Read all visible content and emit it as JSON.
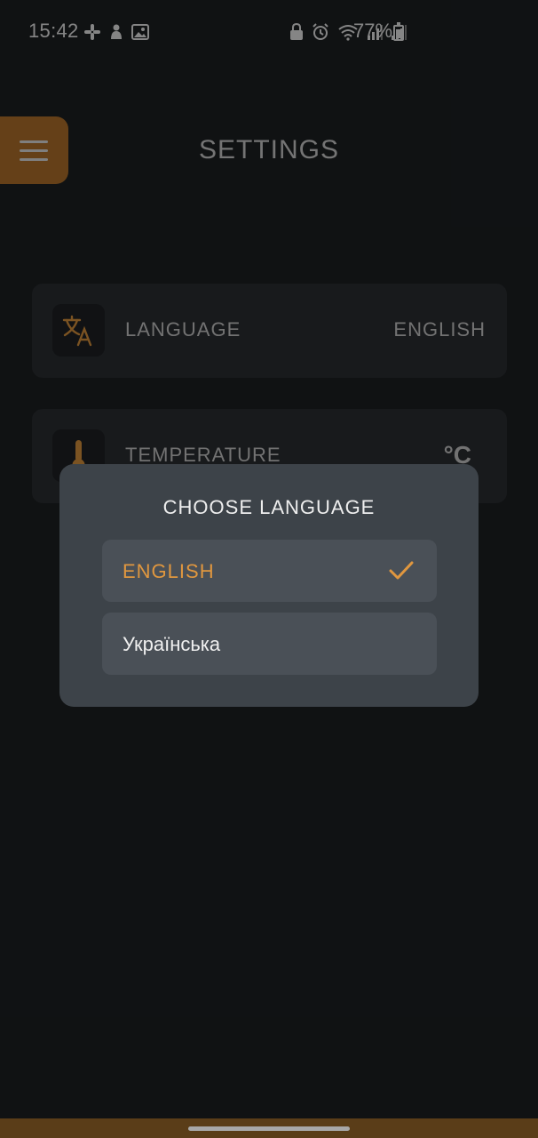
{
  "status_bar": {
    "time": "15:42",
    "battery_percent": "77%",
    "left_icons": [
      "slack-icon",
      "notification-icon",
      "gallery-icon"
    ],
    "right_icons": [
      "lock-icon",
      "alarm-icon",
      "wifi-icon",
      "signal-icon",
      "signal-icon",
      "battery-icon"
    ]
  },
  "header": {
    "title": "SETTINGS",
    "menu_icon": "hamburger-menu-icon"
  },
  "settings": [
    {
      "icon": "translate-icon",
      "label": "LANGUAGE",
      "value": "ENGLISH"
    },
    {
      "icon": "thermometer-icon",
      "label": "TEMPERATURE",
      "value": "°C"
    }
  ],
  "dialog": {
    "title": "CHOOSE LANGUAGE",
    "options": [
      {
        "label": "ENGLISH",
        "selected": true
      },
      {
        "label": "Українська",
        "selected": false
      }
    ]
  },
  "colors": {
    "accent": "#e0973f",
    "menu_button": "#b8762c",
    "background": "#1e2124",
    "card": "#2c3034",
    "dialog": "#3d4349",
    "option": "#4a5057"
  }
}
